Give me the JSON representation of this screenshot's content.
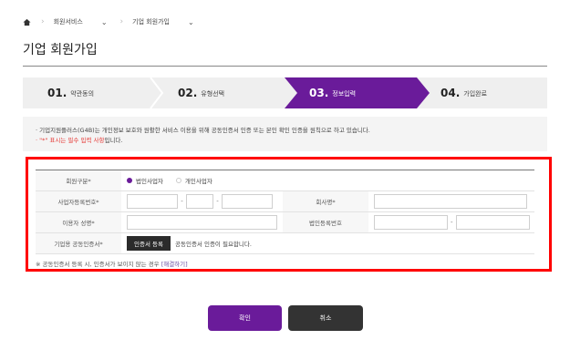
{
  "breadcrumb": {
    "level1": "회원서비스",
    "level2": "기업 회원가입"
  },
  "page_title": "기업 회원가입",
  "steps": [
    {
      "num": "01.",
      "label": "약관동의",
      "active": false
    },
    {
      "num": "02.",
      "label": "유형선택",
      "active": false
    },
    {
      "num": "03.",
      "label": "정보입력",
      "active": true
    },
    {
      "num": "04.",
      "label": "가입완료",
      "active": false
    }
  ],
  "notice": {
    "line1": "· 기업지원플러스(G4B)는 개인정보 보호와 원활한 서비스 이용을 위해 공동인증서 인증 또는 본인 확인 인증을 원칙으로 하고 있습니다.",
    "line2_prefix": "· \"*\" 표시는 필수 입력 사항",
    "line2_suffix": "입니다."
  },
  "form": {
    "member_type_label": "회원구분*",
    "member_type_options": [
      "법인사업자",
      "개인사업자"
    ],
    "member_type_selected": "법인사업자",
    "biz_no_label": "사업자등록번호*",
    "company_label": "회사명*",
    "user_name_label": "이용자 성명*",
    "corp_no_label": "법인등록번호",
    "cert_label": "기업용 공동인증서*",
    "cert_button": "인증서 등록",
    "cert_note": "공동인증서 인증이 필요합니다."
  },
  "footnote": {
    "text": "※ 공동인증서 등록 시, 인증서가 보이지 않는 경우",
    "link": "[해결하기]"
  },
  "buttons": {
    "confirm": "확인",
    "cancel": "취소"
  },
  "colors": {
    "accent": "#6a1b9a",
    "highlight_border": "#ff0000",
    "cancel_bg": "#333333"
  }
}
